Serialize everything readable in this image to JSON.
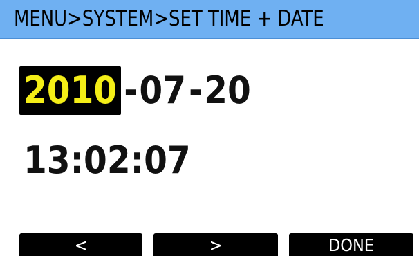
{
  "header": {
    "breadcrumb": "MENU>SYSTEM>SET TIME + DATE"
  },
  "date": {
    "year": "2010",
    "sep1": "-",
    "month": "07",
    "sep2": "-",
    "day": "20",
    "selected_field": "year"
  },
  "time": {
    "hour": "13",
    "sep1": ":",
    "minute": "02",
    "sep2": ":",
    "second": "07"
  },
  "softkeys": {
    "left_label": "<",
    "right_label": ">",
    "done_label": "DONE"
  },
  "colors": {
    "header_bg": "#6fb0f2",
    "selected_bg": "#000000",
    "selected_fg": "#f4ee17",
    "softkey_bg": "#000000",
    "softkey_fg": "#ffffff"
  }
}
